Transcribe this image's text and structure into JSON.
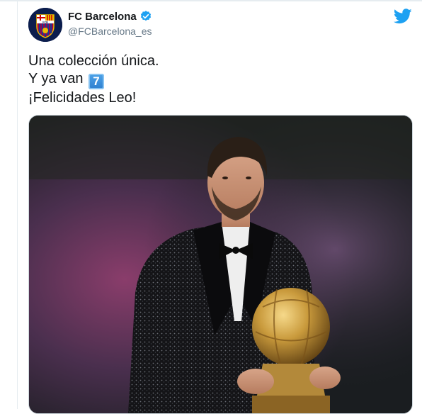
{
  "tweet": {
    "author": {
      "display_name": "FC Barcelona",
      "handle": "@FCBarcelona_es",
      "verified": true,
      "avatar_icon": "fc-barcelona-crest-icon",
      "avatar_crest_text": "FCB"
    },
    "text_lines": [
      "Una colección única.",
      "Y ya van ",
      "¡Felicidades Leo!"
    ],
    "keycap_emoji": "7",
    "media": {
      "type": "photo"
    },
    "brand_icon": "twitter-bird-icon"
  },
  "colors": {
    "text_primary": "#14171a",
    "text_secondary": "#657786",
    "twitter_blue": "#1da1f2",
    "divider": "#e6ecf0"
  }
}
